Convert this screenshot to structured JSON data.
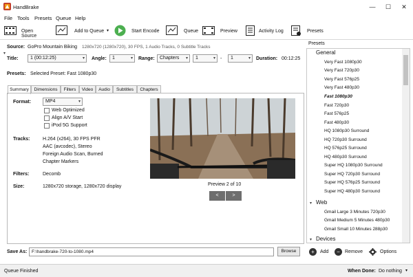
{
  "window": {
    "title": "HandBrake",
    "minimize": "—",
    "maximize": "☐",
    "close": "✕"
  },
  "menu": [
    "File",
    "Tools",
    "Presets",
    "Queue",
    "Help"
  ],
  "toolbar": {
    "open_source": "Open Source",
    "add_to_queue": "Add to Queue",
    "start_encode": "Start Encode",
    "queue": "Queue",
    "preview": "Preview",
    "activity_log": "Activity Log",
    "presets": "Presets"
  },
  "source": {
    "label": "Source:",
    "name": "GoPro Mountain Biking",
    "info": "1280x720 (1280x720), 30 FPS, 1 Audio Tracks, 0 Subtitle Tracks"
  },
  "title_row": {
    "title_label": "Title:",
    "title_value": "1 (00:12:25)",
    "angle_label": "Angle:",
    "angle_value": "1",
    "range_label": "Range:",
    "range_value": "Chapters",
    "range_from": "1",
    "dash": "-",
    "range_to": "1",
    "duration_label": "Duration:",
    "duration_value": "00:12:25"
  },
  "presets_row": {
    "label": "Presets:",
    "value": "Selected Preset: Fast 1080p30"
  },
  "tabs": [
    "Summary",
    "Dimensions",
    "Filters",
    "Video",
    "Audio",
    "Subtitles",
    "Chapters"
  ],
  "summary": {
    "format_label": "Format:",
    "format_value": "MP4",
    "checks": [
      "Web Optimized",
      "Align A/V Start",
      "iPod 5G Support"
    ],
    "tracks_label": "Tracks:",
    "tracks": [
      "H.264 (x264), 30 FPS PFR",
      "AAC (avcodec), Stereo",
      "Foreign Audio Scan, Burned",
      "Chapter Markers"
    ],
    "filters_label": "Filters:",
    "filters_value": "Decomb",
    "size_label": "Size:",
    "size_value": "1280x720 storage, 1280x720 display"
  },
  "preview": {
    "caption": "Preview 2 of 10",
    "prev": "<",
    "next": ">"
  },
  "save_as": {
    "label": "Save As:",
    "value": "F:\\handbrake-720-to-1080.mp4",
    "browse": "Browse"
  },
  "status": {
    "left": "Queue Finished",
    "when_done_label": "When Done:",
    "when_done_value": "Do nothing",
    "when_done_arrow": "▾"
  },
  "presets_panel": {
    "title": "Presets",
    "groups": [
      {
        "name": "General",
        "items": [
          "Very Fast 1080p30",
          "Very Fast 720p30",
          "Very Fast 576p25",
          "Very Fast 480p30",
          "Fast 1080p30",
          "Fast 720p30",
          "Fast 576p25",
          "Fast 480p30",
          "HQ 1080p30 Surround",
          "HQ 720p30 Surround",
          "HQ 576p25 Surround",
          "HQ 480p30 Surround",
          "Super HQ 1080p30 Surround",
          "Super HQ 720p30 Surround",
          "Super HQ 576p25 Surround",
          "Super HQ 480p30 Surround"
        ]
      },
      {
        "name": "Web",
        "items": [
          "Gmail Large 3 Minutes 720p30",
          "Gmail Medium 5 Minutes 480p30",
          "Gmail Small 10 Minutes 288p30"
        ]
      },
      {
        "name": "Devices",
        "items": []
      }
    ],
    "selected": "Fast 1080p30",
    "add": "Add",
    "remove": "Remove",
    "options": "Options"
  }
}
